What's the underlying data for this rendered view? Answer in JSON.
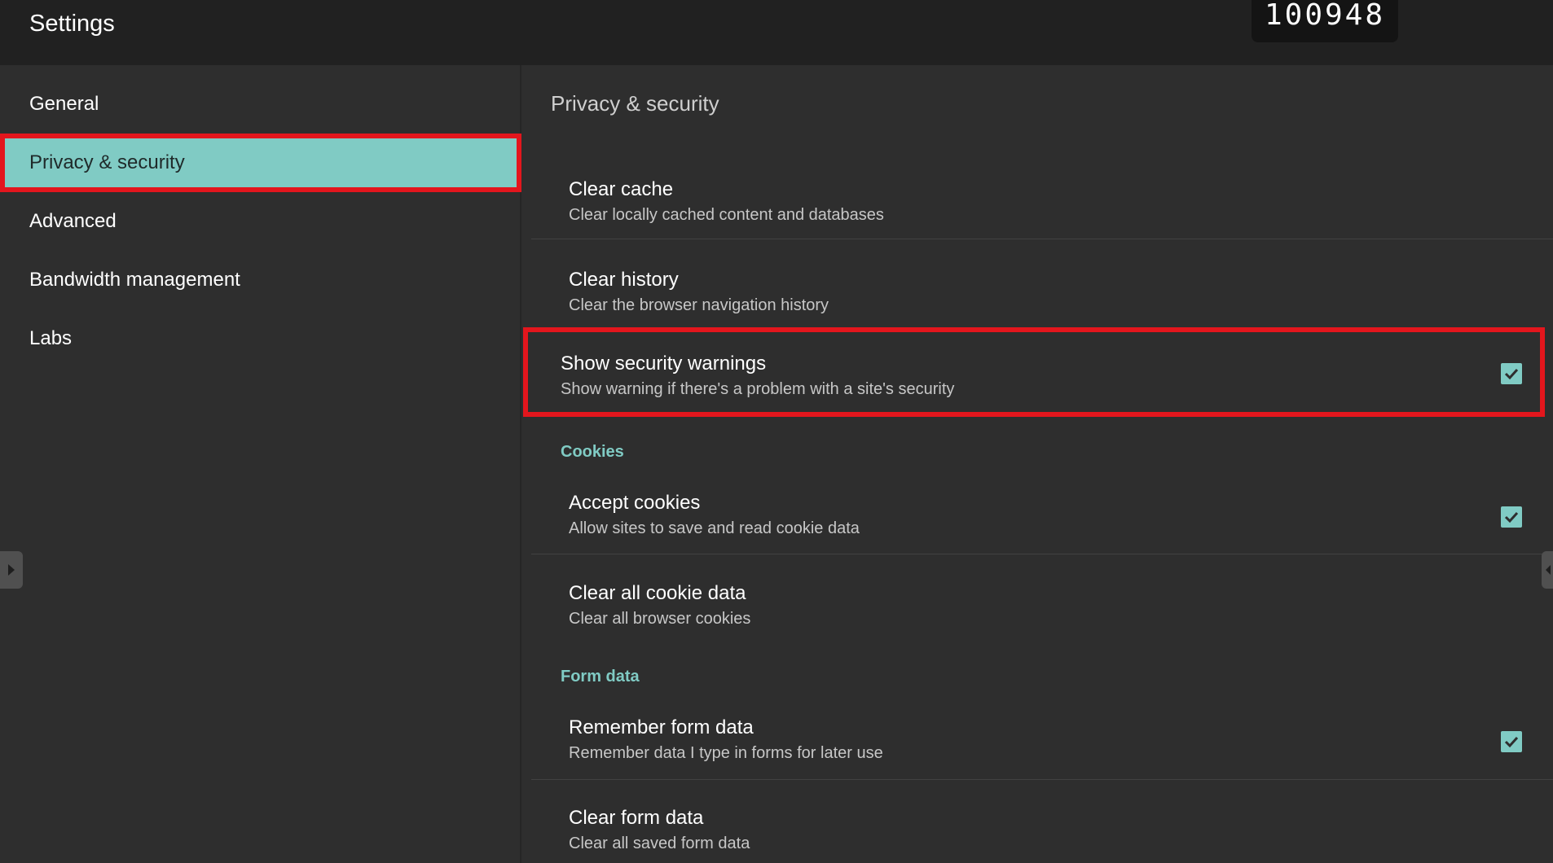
{
  "header": {
    "title": "Settings",
    "counter": "100948"
  },
  "sidebar": {
    "items": [
      {
        "label": "General"
      },
      {
        "label": "Privacy & security",
        "active": true
      },
      {
        "label": "Advanced"
      },
      {
        "label": "Bandwidth management"
      },
      {
        "label": "Labs"
      }
    ]
  },
  "main": {
    "section_title": "Privacy & security",
    "prefs": {
      "clear_cache": {
        "title": "Clear cache",
        "summary": "Clear locally cached content and databases"
      },
      "clear_history": {
        "title": "Clear history",
        "summary": "Clear the browser navigation history"
      },
      "security_warnings": {
        "title": "Show security warnings",
        "summary": "Show warning if there's a problem with a site's security",
        "checked": true
      },
      "cookies_category": "Cookies",
      "accept_cookies": {
        "title": "Accept cookies",
        "summary": "Allow sites to save and read cookie data",
        "checked": true
      },
      "clear_cookies": {
        "title": "Clear all cookie data",
        "summary": "Clear all browser cookies"
      },
      "form_category": "Form data",
      "remember_form": {
        "title": "Remember form data",
        "summary": "Remember data I type in forms for later use",
        "checked": true
      },
      "clear_form": {
        "title": "Clear form data",
        "summary": "Clear all saved form data"
      }
    }
  },
  "colors": {
    "accent": "#80cbc4",
    "highlight": "#e3161d",
    "background": "#2e2e2e",
    "topbar": "#212121"
  },
  "icons": {
    "checkbox": "check-icon",
    "left_handle": "arrow-right-icon",
    "right_handle": "arrow-left-icon"
  }
}
